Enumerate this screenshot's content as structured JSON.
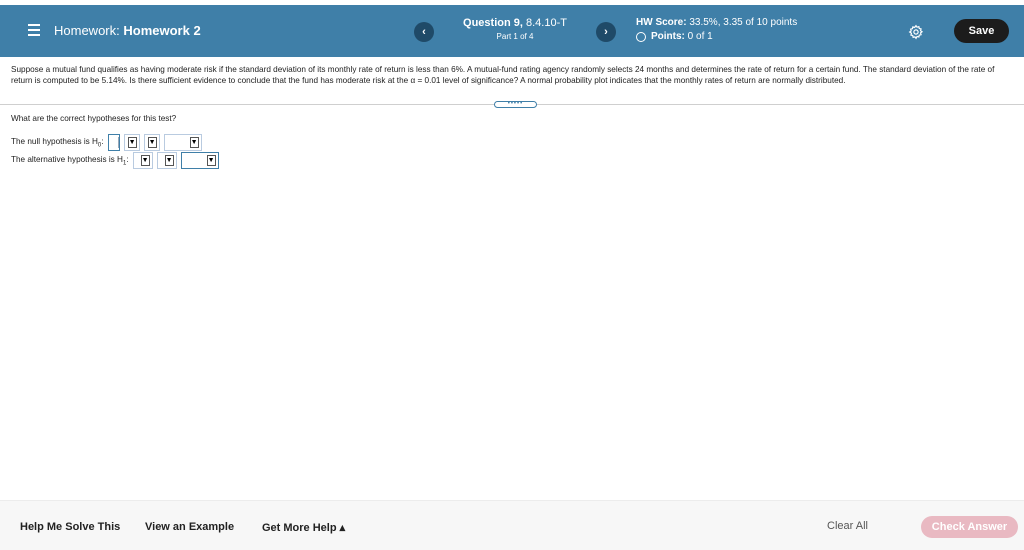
{
  "header": {
    "title_prefix": "Homework:",
    "title_name": "Homework 2",
    "prev_glyph": "‹",
    "next_glyph": "›",
    "question_label": "Question 9,",
    "question_id": " 8.4.10-T",
    "part": "Part 1 of 4",
    "score_label": "HW Score:",
    "score_value": " 33.5%, 3.35 of 10 points",
    "points_label": "Points:",
    "points_value": " 0 of 1",
    "save_label": "Save"
  },
  "problem": {
    "text": "Suppose a mutual fund qualifies as having moderate risk if the standard deviation of its monthly rate of return is less than 6%. A mutual-fund rating agency randomly selects 24 months and determines the rate of return for a certain fund. The standard deviation of the rate of return is computed to be 5.14%. Is there sufficient evidence to conclude that the fund has moderate risk at the α = 0.01 level of significance? A normal probability plot indicates that the monthly rates of return are normally distributed."
  },
  "expand_handle": "•••••",
  "question": {
    "prompt": "What are the correct hypotheses for this test?",
    "null_label": "The null hypothesis is H",
    "null_sub": "0",
    "alt_label": "The alternative hypothesis is H",
    "alt_sub": "1",
    "dropdown_arrow": "▼"
  },
  "footer": {
    "help_solve": "Help Me Solve This",
    "view_example": "View an Example",
    "more_help": "Get More Help ▴",
    "clear_all": "Clear All",
    "check_answer": "Check Answer"
  },
  "colors": {
    "header_bg": "#3f7fa8",
    "nav_button": "#1f4a68",
    "save_button": "#1c1c1c",
    "check_answer_disabled": "#e9b9c2"
  },
  "icons": {
    "menu": "menu-icon",
    "settings": "gear-icon",
    "points_status": "circle-icon"
  }
}
